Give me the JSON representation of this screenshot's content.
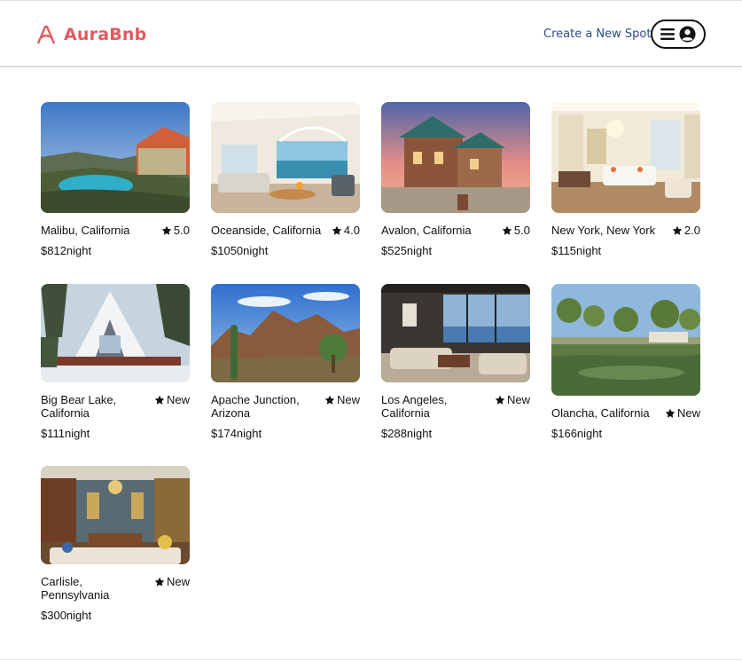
{
  "app": {
    "name": "AuraBnb",
    "accent_color": "#e05a5f",
    "link_color": "#2a4a8c"
  },
  "header": {
    "logo_text": "AuraBnb",
    "logo_icon": "aura-a-logo-icon",
    "create_link": "Create a New Spot",
    "menu_icons": [
      "hamburger-menu-icon",
      "user-circle-icon"
    ]
  },
  "spots": [
    {
      "location": "Malibu, California",
      "rating": "5.0",
      "price": "$812",
      "unit": "night",
      "image": "villa-pool-ocean-view"
    },
    {
      "location": "Oceanside, California",
      "rating": "4.0",
      "price": "$1050",
      "unit": "night",
      "image": "beach-house-living-room"
    },
    {
      "location": "Avalon, California",
      "rating": "5.0",
      "price": "$525",
      "unit": "night",
      "image": "stone-mansion-sunset"
    },
    {
      "location": "New York, New York",
      "rating": "2.0",
      "price": "$115",
      "unit": "night",
      "image": "white-classic-living-room"
    },
    {
      "location": "Big Bear Lake, California",
      "rating": "New",
      "price": "$111",
      "unit": "night",
      "image": "a-frame-cabin-snow"
    },
    {
      "location": "Apache Junction, Arizona",
      "rating": "New",
      "price": "$174",
      "unit": "night",
      "image": "desert-mountains-cactus"
    },
    {
      "location": "Los Angeles, California",
      "rating": "New",
      "price": "$288",
      "unit": "night",
      "image": "modern-glass-living-room"
    },
    {
      "location": "Olancha, California",
      "rating": "New",
      "price": "$166",
      "unit": "night",
      "image": "pond-with-trees-and-rv"
    },
    {
      "location": "Carlisle, Pennsylvania",
      "rating": "New",
      "price": "$300",
      "unit": "night",
      "image": "ornate-library-room"
    }
  ]
}
